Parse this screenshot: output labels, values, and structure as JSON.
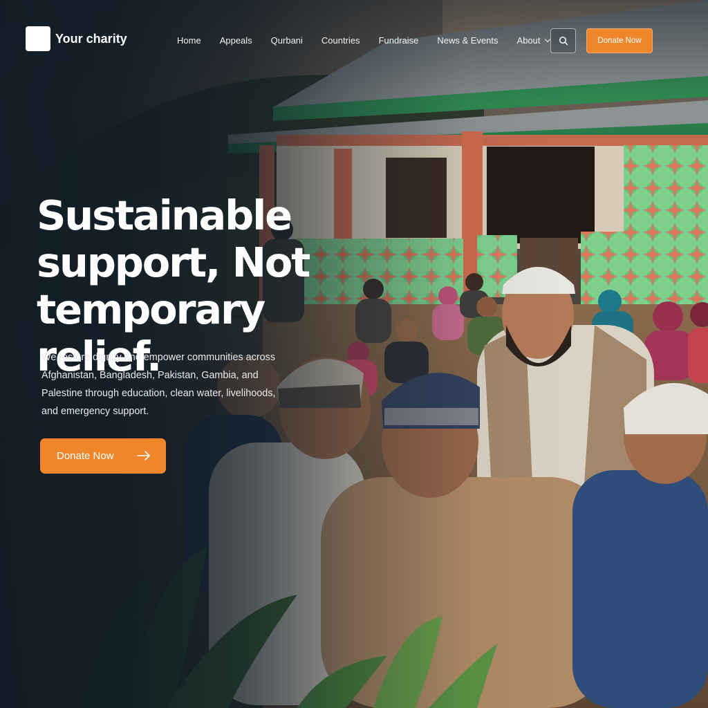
{
  "brand": {
    "name": "Your charity"
  },
  "nav": {
    "items": [
      {
        "label": "Home"
      },
      {
        "label": "Appeals"
      },
      {
        "label": "Qurbani"
      },
      {
        "label": "Countries"
      },
      {
        "label": "Fundraise"
      },
      {
        "label": "News & Events"
      },
      {
        "label": "About",
        "has_dropdown": true
      }
    ],
    "search_icon": "search-icon",
    "donate_label": "Donate Now"
  },
  "hero": {
    "headline_lines": [
      "Sustainable",
      "support, Not",
      "temporary relief."
    ],
    "subtext": "We restore dignity and empower communities across Afghanistan, Bangladesh, Pakistan, Gambia, and Palestine through education, clean water, livelihoods, and emergency support.",
    "cta_label": "Donate Now",
    "cta_icon": "arrow-right-icon"
  },
  "colors": {
    "accent": "#f0862b",
    "overlay": "#111c26",
    "text": "#ffffff"
  }
}
